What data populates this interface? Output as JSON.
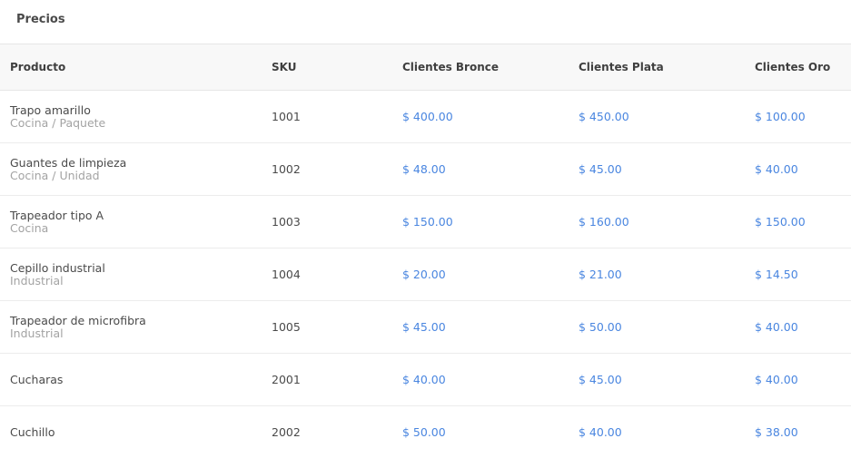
{
  "card": {
    "title": "Precios"
  },
  "table": {
    "headers": {
      "product": "Producto",
      "sku": "SKU",
      "bronze": "Clientes Bronce",
      "silver": "Clientes Plata",
      "gold": "Clientes Oro"
    },
    "rows": [
      {
        "name": "Trapo amarillo",
        "category": "Cocina / Paquete",
        "sku": "1001",
        "bronze": "$ 400.00",
        "silver": "$ 450.00",
        "gold": "$ 100.00"
      },
      {
        "name": "Guantes de limpieza",
        "category": "Cocina / Unidad",
        "sku": "1002",
        "bronze": "$ 48.00",
        "silver": "$ 45.00",
        "gold": "$ 40.00"
      },
      {
        "name": "Trapeador tipo A",
        "category": "Cocina",
        "sku": "1003",
        "bronze": "$ 150.00",
        "silver": "$ 160.00",
        "gold": "$ 150.00"
      },
      {
        "name": "Cepillo industrial",
        "category": "Industrial",
        "sku": "1004",
        "bronze": "$ 20.00",
        "silver": "$ 21.00",
        "gold": "$ 14.50"
      },
      {
        "name": "Trapeador de microfibra",
        "category": "Industrial",
        "sku": "1005",
        "bronze": "$ 45.00",
        "silver": "$ 50.00",
        "gold": "$ 40.00"
      },
      {
        "name": "Cucharas",
        "category": "",
        "sku": "2001",
        "bronze": "$ 40.00",
        "silver": "$ 45.00",
        "gold": "$ 40.00"
      },
      {
        "name": "Cuchillo",
        "category": "",
        "sku": "2002",
        "bronze": "$ 50.00",
        "silver": "$ 40.00",
        "gold": "$ 38.00"
      }
    ]
  },
  "colors": {
    "price": "#4a86e0",
    "muted": "#a3a3a3",
    "header_bg": "#f8f8f8"
  }
}
